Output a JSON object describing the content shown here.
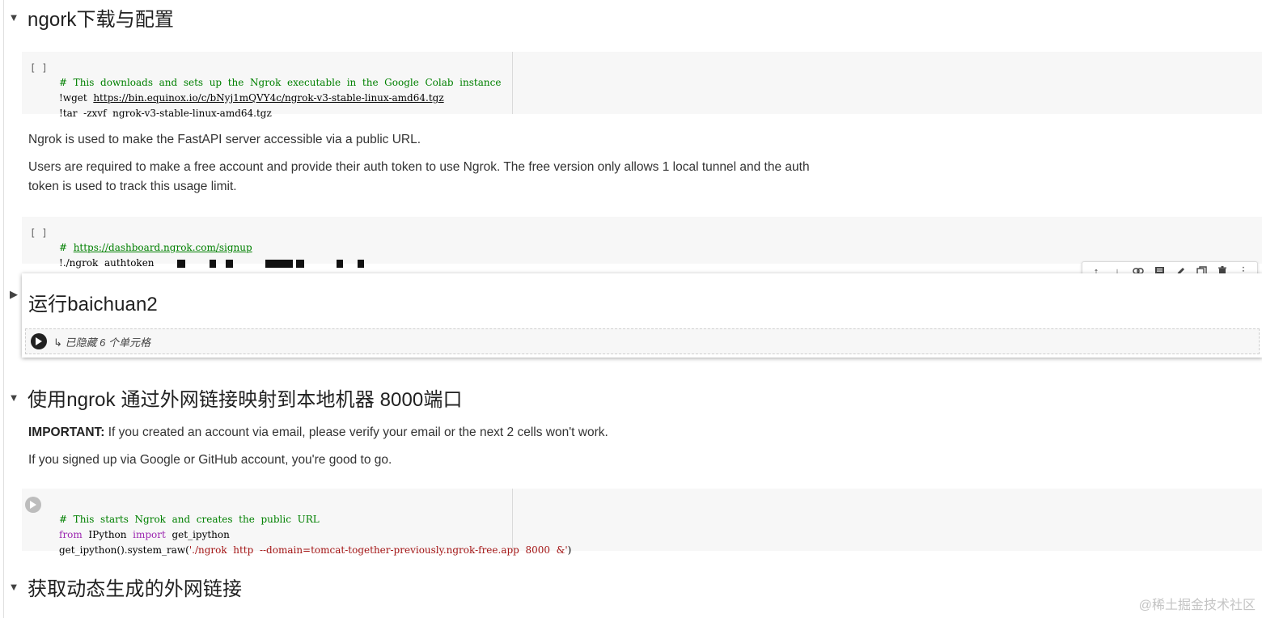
{
  "sections": [
    {
      "title": "ngork下载与配置",
      "expanded": true
    },
    {
      "title": "运行baichuan2",
      "expanded": false,
      "hidden_info": "已隐藏 6 个单元格"
    },
    {
      "title": "使用ngrok 通过外网链接映射到本地机器 8000端口",
      "expanded": true
    },
    {
      "title": "获取动态生成的外网链接",
      "expanded": true
    }
  ],
  "cell1": {
    "bracket": "[ ]",
    "comment": "#  This  downloads  and  sets  up  the  Ngrok  executable  in  the  Google  Colab  instance",
    "line2_cmd": "!wget  ",
    "line2_url": "https://bin.equinox.io/c/bNyj1mQVY4c/ngrok-v3-stable-linux-amd64.tgz",
    "line3": "!tar  -zxvf  ngrok-v3-stable-linux-amd64.tgz"
  },
  "text1": {
    "p1": "Ngrok is used to make the FastAPI server accessible via a public URL.",
    "p2a": "Users are required to make a free account and provide their auth token to use Ngrok. The free version only allows 1 local tunnel and the auth",
    "p2b": "token is used to track this usage limit."
  },
  "cell2": {
    "bracket": "[ ]",
    "comment_prefix": "#  ",
    "comment_url": "https://dashboard.ngrok.com/signup",
    "line2": "!./ngrok  authtoken"
  },
  "text2": {
    "important_label": "IMPORTANT:",
    "important_text": " If you created an account via email, please verify your email or the next 2 cells won't work.",
    "p2": "If you signed up via Google or GitHub account, you're good to go."
  },
  "cell3": {
    "comment": "#  This  starts  Ngrok  and  creates  the  public  URL",
    "kw_from": "from",
    "mod": "  IPython  ",
    "kw_import": "import",
    "imp": "  get_ipython",
    "call": "get_ipython().system_raw(",
    "arg": "'./ngrok  http  --domain=tomcat-together-previously.ngrok-free.app  8000  &'",
    "close": ")"
  },
  "watermark": "@稀土掘金技术社区",
  "colors": {
    "comment": "#008000",
    "keyword": "#9c27b0",
    "string": "#a31515",
    "cell_bg": "#f7f7f7"
  },
  "toolbar_icons": [
    "arrow-up-icon",
    "arrow-down-icon",
    "link-icon",
    "comment-icon",
    "edit-icon",
    "mirror-cell-icon",
    "delete-icon",
    "more-icon"
  ]
}
